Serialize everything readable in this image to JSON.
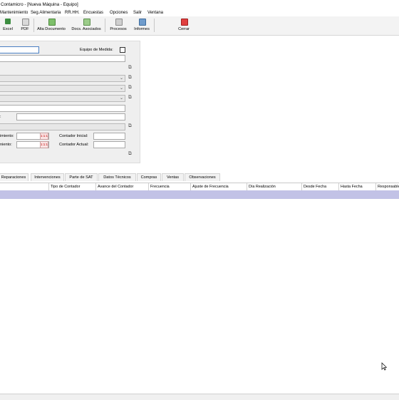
{
  "window": {
    "title": "Contamicro - [Nueva Máquina - Equipo]"
  },
  "menu": [
    "Mantenimiento",
    "Seg.Alimentaria",
    "RR.HH.",
    "Encuestas",
    "Opciones",
    "Salir",
    "Ventana"
  ],
  "toolbar": {
    "excel": "Excel",
    "pdf": "PDF",
    "alta_documento": "Alta Documento",
    "docs_asociados": "Docs. Asociados",
    "procesos": "Procesos",
    "informes": "Informes",
    "cerrar": "Cerrar"
  },
  "form": {
    "equipo_medida_label": "Equipo de Medida:",
    "partial_label_1": ":",
    "mantenimiento_label": "imiento:",
    "mantenimiento2_label": "niento:",
    "contador_inicial_label": "Contador Inicial:",
    "contador_actual_label": "Contador Actual:",
    "spin_glyph": "1:1:1"
  },
  "tabs": [
    "Reparaciones",
    "Intervenciones",
    "Parte de SAT",
    "Datos Técnicos",
    "Compras",
    "Ventas",
    "Observaciones"
  ],
  "grid": {
    "columns": [
      "",
      "Tipo de Contador",
      "Avance del Contador",
      "Frecuencia",
      "Ajuste de Frecuencia",
      "Día Realización",
      "Desde Fecha",
      "Hasta Fecha",
      "Responsable"
    ]
  },
  "icons": {
    "link": "external-link-icon",
    "combo": "chevron-down-icon"
  }
}
